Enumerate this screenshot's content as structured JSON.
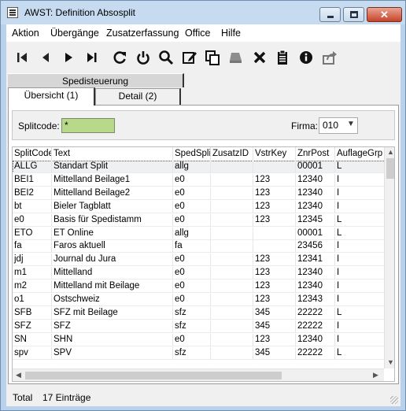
{
  "window": {
    "title": "AWST: Definition Absosplit"
  },
  "menu": [
    "Aktion",
    "Übergänge",
    "Zusatzerfassung",
    "Office",
    "Hilfe"
  ],
  "toolbar": [
    "first-record-icon",
    "previous-record-icon",
    "next-record-icon",
    "last-record-icon",
    "refresh-icon",
    "power-icon",
    "search-icon",
    "edit-icon",
    "copy-icon",
    "stack-icon",
    "delete-icon",
    "clipboard-icon",
    "info-icon",
    "export-icon"
  ],
  "tabs": {
    "upper": "Spedisteuerung",
    "lower": [
      "Übersicht (1)",
      "Detail (2)"
    ],
    "active": 0
  },
  "filter": {
    "splitcode_label": "Splitcode:",
    "splitcode_value": "*",
    "firma_label": "Firma:",
    "firma_value": "010"
  },
  "table": {
    "columns": [
      "SplitCode",
      "Text",
      "SpedSplit",
      "ZusatzID",
      "VstrKey",
      "ZnrPost",
      "AuflageGrp"
    ],
    "rows": [
      [
        "ALLG",
        "Standart Split",
        "allg",
        "",
        "",
        "00001",
        "L"
      ],
      [
        "BEI1",
        "Mittelland Beilage1",
        "e0",
        "",
        "123",
        "12340",
        "I"
      ],
      [
        "BEI2",
        "Mittelland Beilage2",
        "e0",
        "",
        "123",
        "12340",
        "I"
      ],
      [
        "bt",
        "Bieler Tagblatt",
        "e0",
        "",
        "123",
        "12340",
        "I"
      ],
      [
        "e0",
        "Basis für Spedistamm",
        "e0",
        "",
        "123",
        "12345",
        "L"
      ],
      [
        "ETO",
        "ET Online",
        "allg",
        "",
        "",
        "00001",
        "L"
      ],
      [
        "fa",
        "Faros aktuell",
        "fa",
        "",
        "",
        "23456",
        "I"
      ],
      [
        "jdj",
        "Journal du Jura",
        "e0",
        "",
        "123",
        "12341",
        "I"
      ],
      [
        "m1",
        "Mittelland",
        "e0",
        "",
        "123",
        "12340",
        "I"
      ],
      [
        "m2",
        "Mittelland mit Beilage",
        "e0",
        "",
        "123",
        "12340",
        "I"
      ],
      [
        "o1",
        "Ostschweiz",
        "e0",
        "",
        "123",
        "12343",
        "I"
      ],
      [
        "SFB",
        "SFZ mit Beilage",
        "sfz",
        "",
        "345",
        "22222",
        "L"
      ],
      [
        "SFZ",
        "SFZ",
        "sfz",
        "",
        "345",
        "22222",
        "I"
      ],
      [
        "SN",
        "SHN",
        "e0",
        "",
        "123",
        "12340",
        "I"
      ],
      [
        "spv",
        "SPV",
        "sfz",
        "",
        "345",
        "22222",
        "L"
      ]
    ],
    "selected_row": 0
  },
  "status": {
    "label": "Total",
    "count": "17 Einträge"
  }
}
